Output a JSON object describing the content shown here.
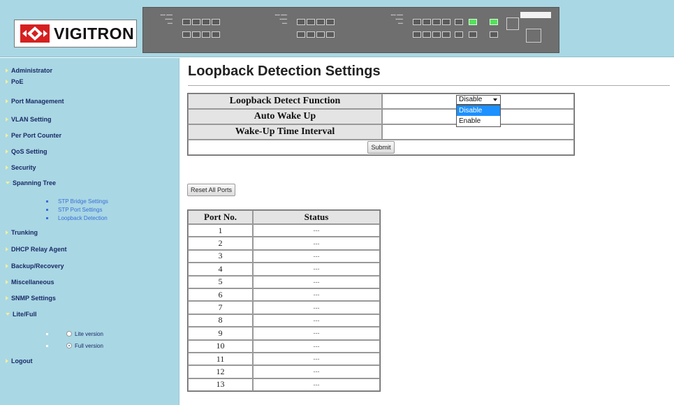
{
  "brand": {
    "name": "VIGITRON"
  },
  "sidebar": {
    "items": [
      {
        "label": "Administrator"
      },
      {
        "label": "PoE"
      },
      {
        "label": "Port Management"
      },
      {
        "label": "VLAN Setting"
      },
      {
        "label": "Per Port Counter"
      },
      {
        "label": "QoS Setting"
      },
      {
        "label": "Security"
      },
      {
        "label": "Spanning Tree"
      },
      {
        "label": "Trunking"
      },
      {
        "label": "DHCP Relay Agent"
      },
      {
        "label": "Backup/Recovery"
      },
      {
        "label": "Miscellaneous"
      },
      {
        "label": "SNMP Settings"
      },
      {
        "label": "Lite/Full"
      },
      {
        "label": "Logout"
      }
    ],
    "spanning_tree_sub": [
      {
        "label": "STP Bridge Settings"
      },
      {
        "label": "STP Port Settings"
      },
      {
        "label": "Loopback Detection"
      }
    ],
    "lite_full_options": [
      {
        "label": "Lite version",
        "checked": false
      },
      {
        "label": "Full version",
        "checked": true
      }
    ]
  },
  "main": {
    "title": "Loopback Detection Settings",
    "settings": {
      "rows": [
        {
          "label": "Loopback Detect Function"
        },
        {
          "label": "Auto Wake Up"
        },
        {
          "label": "Wake-Up Time Interval"
        }
      ],
      "submit_label": "Submit"
    },
    "select": {
      "value": "Disable",
      "options": [
        "Disable",
        "Enable"
      ],
      "highlighted": "Disable"
    },
    "reset_label": "Reset All Ports",
    "ports_table": {
      "headers": [
        "Port No.",
        "Status"
      ],
      "rows": [
        {
          "port": "1",
          "status": "---"
        },
        {
          "port": "2",
          "status": "---"
        },
        {
          "port": "3",
          "status": "---"
        },
        {
          "port": "4",
          "status": "---"
        },
        {
          "port": "5",
          "status": "---"
        },
        {
          "port": "6",
          "status": "---"
        },
        {
          "port": "7",
          "status": "---"
        },
        {
          "port": "8",
          "status": "---"
        },
        {
          "port": "9",
          "status": "---"
        },
        {
          "port": "10",
          "status": "---"
        },
        {
          "port": "11",
          "status": "---"
        },
        {
          "port": "12",
          "status": "---"
        },
        {
          "port": "13",
          "status": "---"
        }
      ]
    }
  },
  "colors": {
    "sidebar_bg": "#a9d7e4",
    "nav_text": "#1a2a66",
    "sub_link": "#3a6ed8",
    "port_lit": "#55e05b",
    "select_highlight": "#1e90ff"
  }
}
